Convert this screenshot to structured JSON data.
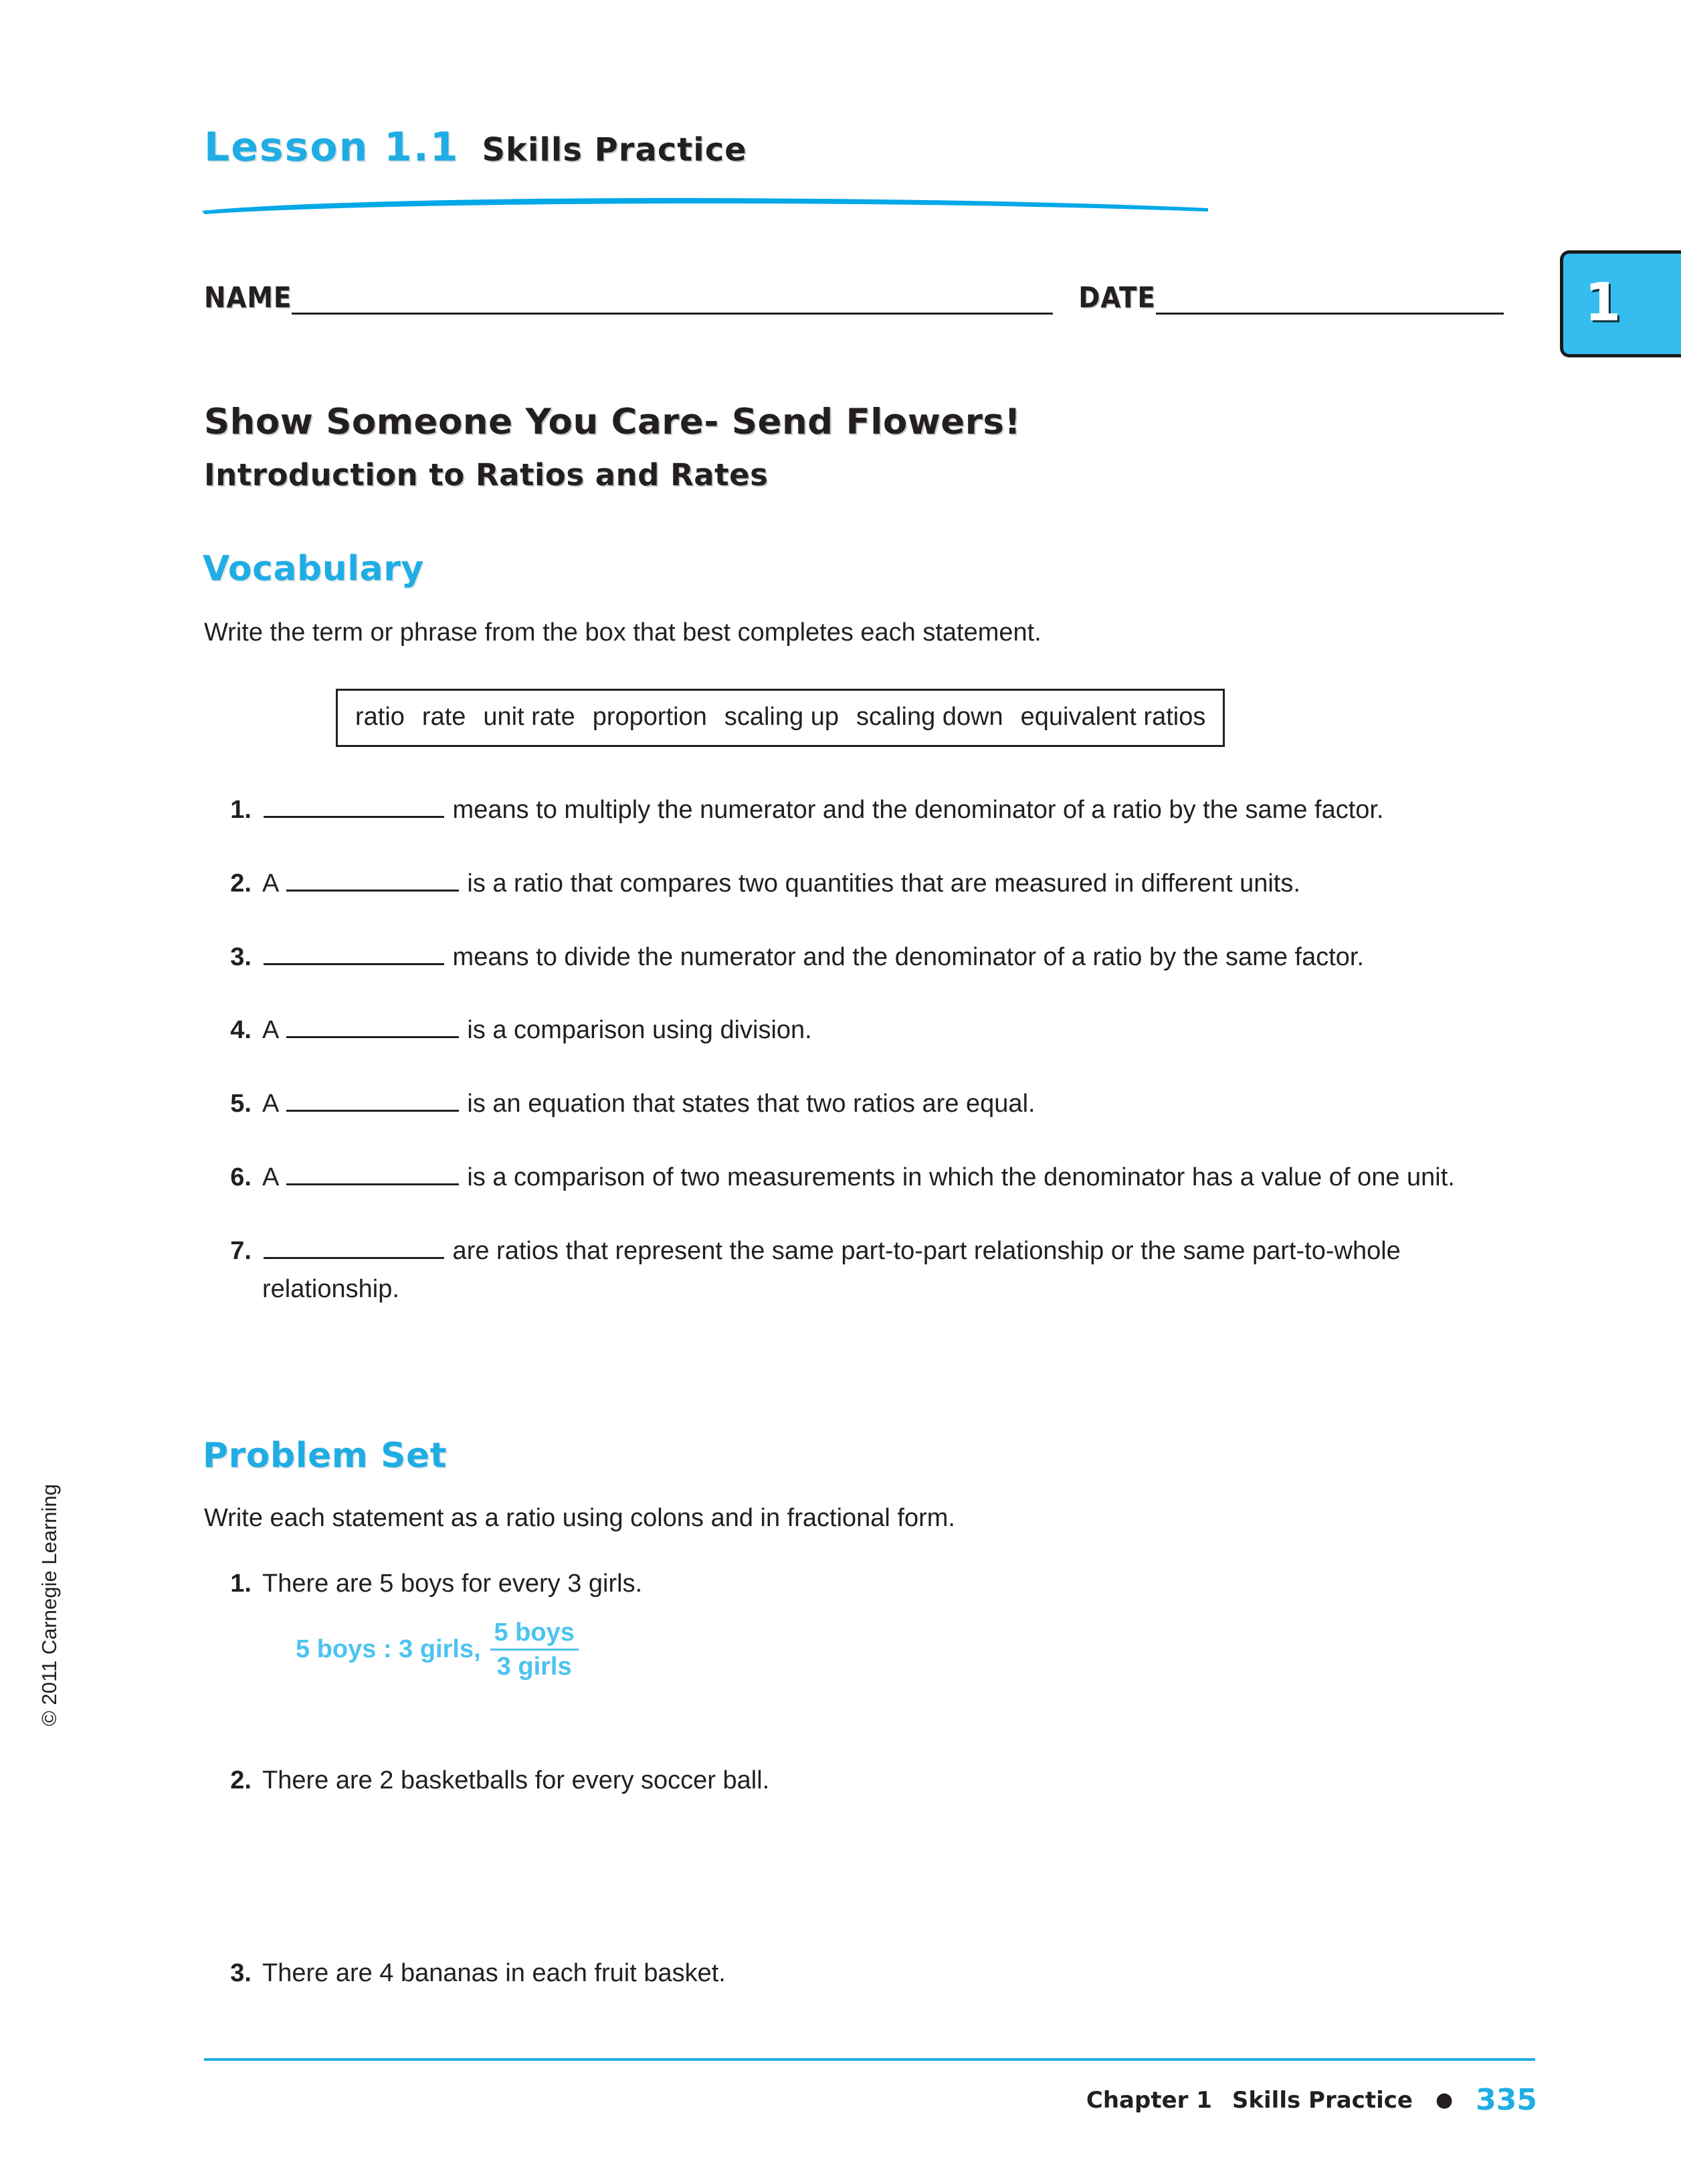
{
  "header": {
    "lesson_label": "Lesson 1.1",
    "lesson_sub": "Skills Practice",
    "chapter_tab_number": "1"
  },
  "fields": {
    "name_label": "NAME",
    "date_label": "DATE"
  },
  "titles": {
    "main": "Show Someone You Care- Send Flowers!",
    "sub": "Introduction to Ratios and Rates"
  },
  "vocabulary": {
    "heading": "Vocabulary",
    "instruction": "Write the term or phrase from the box that best completes each statement.",
    "word_bank": [
      "ratio",
      "rate",
      "unit rate",
      "proportion",
      "scaling up",
      "scaling down",
      "equivalent ratios"
    ],
    "items": [
      {
        "number": "1.",
        "prefix": "",
        "after": " means to multiply the numerator and the denominator of a ratio by the same factor."
      },
      {
        "number": "2.",
        "prefix": "A ",
        "after": " is a ratio that compares two quantities that are measured in different units."
      },
      {
        "number": "3.",
        "prefix": "",
        "after": " means to divide the numerator and the denominator of a ratio by the same factor."
      },
      {
        "number": "4.",
        "prefix": "A ",
        "after": " is a comparison using division."
      },
      {
        "number": "5.",
        "prefix": "A ",
        "after": " is an equation that states that two ratios are equal."
      },
      {
        "number": "6.",
        "prefix": "A ",
        "after": " is a comparison of two measurements in which the denominator has a value of one unit."
      },
      {
        "number": "7.",
        "prefix": "",
        "after": " are ratios that represent the same part-to-part relationship or the same part-to-whole relationship."
      }
    ]
  },
  "problem_set": {
    "heading": "Problem Set",
    "instruction": "Write each statement as a ratio using colons and in fractional form.",
    "items": [
      {
        "number": "1.",
        "text": "There are 5 boys for every 3 girls.",
        "answer": {
          "colon_form": "5 boys : 3 girls,",
          "fraction_numerator": "5 boys",
          "fraction_denominator": "3 girls"
        }
      },
      {
        "number": "2.",
        "text": "There are 2 basketballs for every soccer ball."
      },
      {
        "number": "3.",
        "text": "There are 4 bananas in each fruit basket."
      }
    ]
  },
  "copyright": "© 2011 Carnegie Learning",
  "footer": {
    "chapter": "Chapter 1",
    "section": "Skills Practice",
    "separator": "●",
    "page_number": "335"
  },
  "colors": {
    "accent_cyan": "#1fade4",
    "answer_cyan": "#4cc3f0",
    "tab_cyan": "#35bdf0",
    "ink": "#231f20"
  }
}
